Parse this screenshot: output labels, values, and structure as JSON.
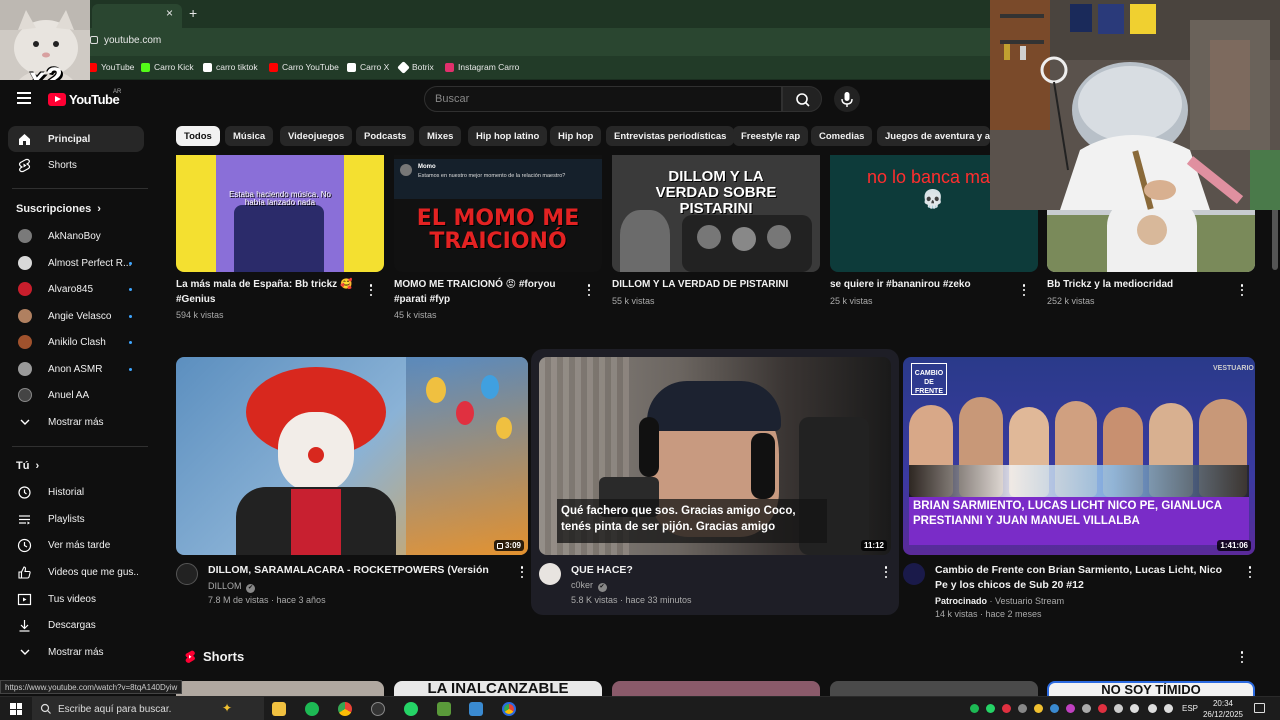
{
  "browser": {
    "tab_close": "×",
    "tab_new": "+",
    "url": "youtube.com",
    "bookmarks": [
      {
        "label": "YouTube",
        "color": "#ff0000"
      },
      {
        "label": "Carro Kick",
        "color": "#53fc18"
      },
      {
        "label": "carro tiktok",
        "color": "#ffffff"
      },
      {
        "label": "Carro YouTube",
        "color": "#ff0000"
      },
      {
        "label": "Carro X",
        "color": "#ffffff"
      },
      {
        "label": "Botrix",
        "color": "#ffffff"
      },
      {
        "label": "Instagram Carro",
        "color": "#e1306c"
      }
    ],
    "overlay_badge": "x2"
  },
  "header": {
    "logo_text": "YouTube",
    "country_code": "AR",
    "search_placeholder": "Buscar"
  },
  "sidebar": {
    "main": [
      {
        "label": "Principal",
        "icon": "home-icon"
      },
      {
        "label": "Shorts",
        "icon": "shorts-icon"
      }
    ],
    "subscriptions_title": "Suscripciones",
    "subscriptions": [
      {
        "label": "AkNanoBoy",
        "color": "#7a7a7a",
        "dot": false
      },
      {
        "label": "Almost Perfect R...",
        "color": "#d9d9d9",
        "dot": true
      },
      {
        "label": "Alvaro845",
        "color": "#c81e2c",
        "dot": true
      },
      {
        "label": "Angie Velasco",
        "color": "#b08060",
        "dot": true
      },
      {
        "label": "Anikilo Clash",
        "color": "#a0522d",
        "dot": true
      },
      {
        "label": "Anon ASMR",
        "color": "#9a9a9a",
        "dot": true
      },
      {
        "label": "Anuel AA",
        "color": "#444444",
        "dot": false
      }
    ],
    "subs_more": "Mostrar más",
    "you_title": "Tú",
    "you_items": [
      {
        "label": "Historial",
        "icon": "history-icon"
      },
      {
        "label": "Playlists",
        "icon": "playlists-icon"
      },
      {
        "label": "Ver más tarde",
        "icon": "watch-later-icon"
      },
      {
        "label": "Videos que me gus...",
        "icon": "liked-videos-icon"
      },
      {
        "label": "Tus videos",
        "icon": "your-videos-icon"
      },
      {
        "label": "Descargas",
        "icon": "downloads-icon"
      }
    ],
    "you_more": "Mostrar más"
  },
  "chips": [
    "Todos",
    "Música",
    "Videojuegos",
    "Podcasts",
    "Mixes",
    "Hip hop latino",
    "Hip hop",
    "Entrevistas periodísticas",
    "Freestyle rap",
    "Comedias",
    "Juegos de aventura y acc"
  ],
  "row1": [
    {
      "title": "La más mala de España: Bb trickz 🥰 #Genius",
      "meta": "594 k vistas",
      "thumb_text": "Estaba haciendo música. No había lanzado nada",
      "colors": [
        "#f4e030",
        "#8a6fd8"
      ]
    },
    {
      "title": "MOMO ME TRAICIONÓ 😡 #foryou #parati #fyp",
      "meta": "45 k vistas",
      "thumb_text": "EL MOMO ME TRAICIONÓ",
      "tweet_name": "Momo",
      "tweet_body": "Estamos en nuestro mejor momento de la relación maestro?",
      "colors": [
        "#111111",
        "#d62020"
      ]
    },
    {
      "title": "DILLOM Y LA VERDAD DE PISTARINI",
      "meta": "55 k vistas",
      "thumb_text": "DILLOM Y LA VERDAD SOBRE PISTARINI",
      "colors": [
        "#3a3a3a",
        "#1e1e1e"
      ]
    },
    {
      "title": "se quiere ir #bananirou #zeko",
      "meta": "25 k vistas",
      "thumb_text": "no lo banca mas 💀",
      "colors": [
        "#0d3b3a",
        "#0a2a2a"
      ]
    },
    {
      "title": "Bb Trickz y la mediocridad",
      "meta": "252 k vistas",
      "colors": [
        "#d8dce0",
        "#a0a8b0"
      ]
    }
  ],
  "row2": [
    {
      "title": "DILLOM, SARAMALACARA - ROCKETPOWERS (Versión Legal)",
      "channel": "DILLOM",
      "verified": "✔",
      "meta": "7.8 M de vistas · hace 3 años",
      "duration": "3:09",
      "colors": [
        "#5c8fbf",
        "#d8281e"
      ]
    },
    {
      "title": "QUE HACE?",
      "channel": "c0ker",
      "verified": "✔",
      "meta": "5.8 K vistas · hace 33 minutos",
      "duration": "11:12",
      "caption": "Qué fachero que sos. Gracias amigo Coco, tenés pinta de ser pijón. Gracias amigo",
      "colors": [
        "#8a8580",
        "#1a1a1a"
      ]
    },
    {
      "title": "Cambio de Frente con Brian Sarmiento, Lucas Licht, Nico Pe y los chicos de Sub 20 #12",
      "channel": "Patrocinado",
      "channel_extra": "· Vestuario Stream",
      "meta": "14 k vistas · hace 2 meses",
      "duration": "1:41:06",
      "banner": "BRIAN SARMIENTO, LUCAS LICHT NICO PE, GIANLUCA PRESTIANNI Y JUAN MANUEL VILLALBA",
      "badge_left": "CAMBIO DE FRENTE",
      "badge_right": "VESTUARIO",
      "colors": [
        "#2a3a8a",
        "#5a2a9a"
      ]
    }
  ],
  "shorts_title": "Shorts",
  "shorts_previews": [
    "",
    "LA INALCANZABLE",
    "",
    "",
    "NO SOY TÍMIDO"
  ],
  "status_url": "https://www.youtube.com/watch?v=8tqA140Dyiw",
  "taskbar": {
    "search_placeholder": "Escribe aquí para buscar.",
    "lang": "ESP",
    "time": "20:34",
    "date": "26/12/2025"
  }
}
